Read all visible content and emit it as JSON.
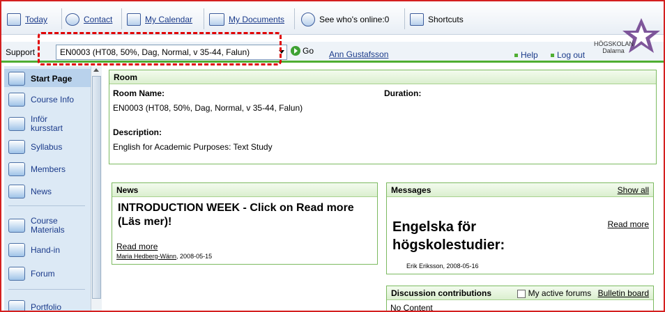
{
  "toolbar": {
    "today": "Today",
    "contact": "Contact",
    "calendar": "My Calendar",
    "documents": "My Documents",
    "online": "See who's online:0",
    "shortcuts": "Shortcuts"
  },
  "logo": {
    "line1": "HÖGSKOLAN",
    "line2": "Dalarna"
  },
  "coursebar": {
    "support": "Support",
    "course": "EN0003 (HT08, 50%, Dag, Normal, v 35-44, Falun)",
    "go": "Go",
    "user": "Ann Gustafsson",
    "help": "Help",
    "logout": "Log out"
  },
  "sidebar": {
    "items": [
      {
        "label": "Start Page",
        "icon": "house-icon"
      },
      {
        "label": "Course Info",
        "icon": "info-icon"
      },
      {
        "label": "Inför kursstart",
        "icon": "people-icon"
      },
      {
        "label": "Syllabus",
        "icon": "people-icon"
      },
      {
        "label": "Members",
        "icon": "members-icon"
      },
      {
        "label": "News",
        "icon": "news-icon"
      },
      {
        "label": "Course Materials",
        "icon": "folder-icon"
      },
      {
        "label": "Hand-in",
        "icon": "handin-icon"
      },
      {
        "label": "Forum",
        "icon": "forum-icon"
      },
      {
        "label": "Portfolio",
        "icon": "portfolio-icon"
      }
    ]
  },
  "room": {
    "heading": "Room",
    "name_label": "Room Name:",
    "name_value": "EN0003 (HT08, 50%, Dag, Normal, v 35-44, Falun)",
    "duration_label": "Duration:",
    "description_label": "Description:",
    "description_value": "English for Academic Purposes: Text Study"
  },
  "news": {
    "heading": "News",
    "title": "INTRODUCTION WEEK - Click on Read more (Läs mer)!",
    "read_more": "Read more",
    "author": "Maria Hedberg-Wänn",
    "date": ", 2008-05-15"
  },
  "messages": {
    "heading": "Messages",
    "show_all": "Show all",
    "title": "Engelska för högskolestudier:",
    "read_more": "Read more",
    "author": "Erik Eriksson, 2008-05-16"
  },
  "discussion": {
    "heading": "Discussion contributions",
    "my_forums": "My active forums",
    "bulletin": "Bulletin board",
    "content": "No Content"
  }
}
